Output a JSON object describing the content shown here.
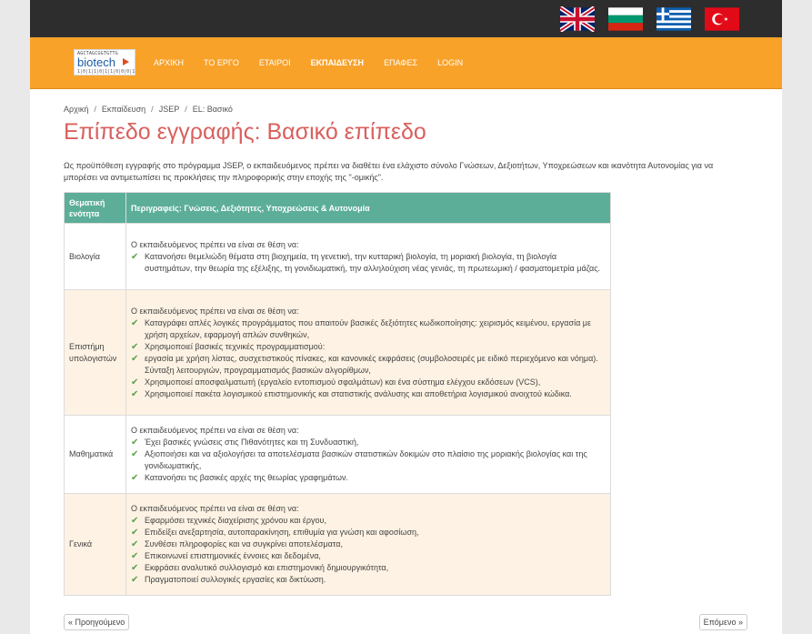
{
  "flags": [
    {
      "name": "uk-flag-icon",
      "lang": "EN"
    },
    {
      "name": "bulgaria-flag-icon",
      "lang": "BG"
    },
    {
      "name": "greece-flag-icon",
      "lang": "EL"
    },
    {
      "name": "turkey-flag-icon",
      "lang": "TR"
    }
  ],
  "logo": {
    "dna": "AGCTAGCGGTGTTG",
    "text": "biotech",
    "dots": "1|0|1|1|0|1|1|0|0|0|1"
  },
  "nav": {
    "home": "ΑΡΧΙΚΗ",
    "project": "ΤΟ ΕΡΓΟ",
    "partners": "ΕΤΑΙΡΟΙ",
    "education": "ΕΚΠΑΙΔΕΥΣΗ",
    "contact": "ΕΠΑΦΕΣ",
    "login": "LOGIN"
  },
  "breadcrumb": [
    "Αρχική",
    "Εκπαίδευση",
    "JSEP",
    "EL: Βασικό"
  ],
  "title": "Επίπεδο εγγραφής: Βασικό επίπεδο",
  "intro": "Ως προϋπόθεση εγγραφής στο πρόγραμμα JSEP, ο εκπαιδευόμενος πρέπει να διαθέτει ένα ελάχιστο σύνολο Γνώσεων, Δεξιοτήτων, Υποχρεώσεων και ικανότητα Αυτονομίας για να μπορέσει να αντιμετωπίσει τις προκλήσεις την πληροφορικής στην εποχής της \"-ομικής\".",
  "table": {
    "col1": "Θεματική ενότητα",
    "col2": "Περιγραφείς: Γνώσεις, Δεξιότητες, Υποχρεώσεις & Αυτονομία",
    "rows": [
      {
        "topic": "Βιολογία",
        "lead": "Ο εκπαιδευόμενος πρέπει να είναι σε θέση να:",
        "items": [
          "Κατανοήσει θεμελιώδη θέματα στη βιοχημεία, τη γενετική, την κυτταρική βιολογία, τη μοριακή βιολογία, τη βιολογία συστημάτων, την θεωρία της εξέλιξης, τη γονιδιωματική, την αλληλούχιση νέας γενιάς, τη πρωτεωμική / φασματομετρία μάζας."
        ]
      },
      {
        "topic": "Επιστήμη υπολογιστών",
        "lead": "Ο εκπαιδευόμενος πρέπει να είναι σε θέση να:",
        "items": [
          "Καταγράφει απλές λογικές προγράμματος που απαιτούν βασικές δεξιότητες κωδικοποίησης: χειρισμός κειμένου, εργασία με χρήση αρχείων, εφαρμογή απλών συνθηκών,",
          "Χρησιμοποιεί βασικές τεχνικές προγραμματισμού:",
          "εργασία με χρήση λίστας, συσχετιστικούς πίνακες, και κανονικές εκφράσεις (συμβολοσειρές με ειδικό περιεχόμενο και νόημα). Σύνταξη λειτουργιών, προγραμματισμός βασικών αλγορίθμων,",
          "Χρησιμοποιεί αποσφαλματωτή (εργαλείο εντοπισμού σφαλμάτων) και ένα σύστημα ελέγχου εκδόσεων (VCS),",
          "Χρησιμοποιεί πακέτα λογισμικού επιστημονικής και στατιστικής ανάλυσης και αποθετήρια λογισμικού ανοιχτού κώδικα."
        ]
      },
      {
        "topic": "Μαθηματικά",
        "lead": "Ο εκπαιδευόμενος πρέπει να είναι σε θέση να:",
        "items": [
          "Έχει βασικές γνώσεις στις Πιθανότητες και τη Συνδυαστική,",
          "Αξιοποιήσει και να αξιολογήσει τα αποτελέσματα βασικών στατιστικών δοκιμών στο πλαίσιο της μοριακής βιολογίας και της γονιδιωματικής,",
          "Κατανοήσει τις βασικές αρχές της θεωρίας γραφημάτων."
        ]
      },
      {
        "topic": "Γενικά",
        "lead": "Ο εκπαιδευόμενος πρέπει να είναι σε θέση να:",
        "items": [
          "Εφαρμόσει τεχνικές διαχείρισης χρόνου και έργου,",
          "Επιδείξει ανεξαρτησία, αυτοπαρακίνηση, επιθυμία για γνώση και αφοσίωση,",
          "Συνθέσει πληροφορίες και να συγκρίνει αποτελέσματα,",
          "Επικοινωνεί επιστημονικές έννοιες και δεδομένα,",
          "Εκφράσει αναλυτικό συλλογισμό και επιστημονική δημιουργικότητα,",
          "Πραγματοποιεί συλλογικές εργασίες και δικτύωση."
        ]
      }
    ]
  },
  "pager": {
    "prev": "« Προηγούμενο",
    "next": "Επόμενο »"
  },
  "colors": {
    "accent_orange": "#f8a22a",
    "title_red": "#d9605e",
    "table_header_green": "#5cae99",
    "row_tint": "#fdf2e3",
    "check_green": "#5aa14a"
  }
}
